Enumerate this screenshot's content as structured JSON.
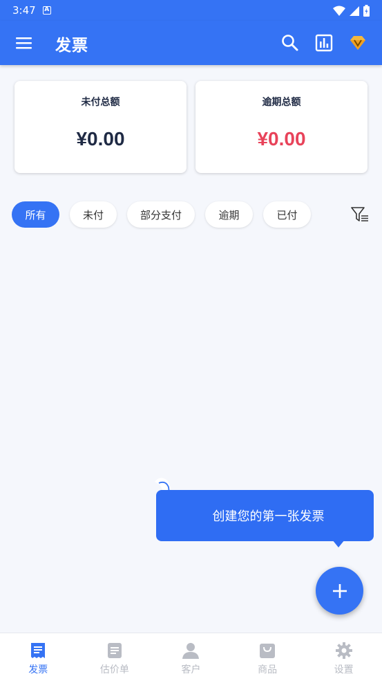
{
  "status_bar": {
    "time": "3:47",
    "notification_badge": "A"
  },
  "app_bar": {
    "title": "发票",
    "icons": [
      "menu-icon",
      "search-icon",
      "chart-icon",
      "premium-gem-icon"
    ]
  },
  "summary": {
    "unpaid": {
      "label": "未付总额",
      "amount": "¥0.00",
      "color": "#1f2a44"
    },
    "overdue": {
      "label": "逾期总额",
      "amount": "¥0.00",
      "color": "#e8435a"
    }
  },
  "filters": {
    "chips": [
      "所有",
      "未付",
      "部分支付",
      "逾期",
      "已付"
    ],
    "selected": "所有"
  },
  "tooltip": {
    "text": "创建您的第一张发票"
  },
  "bottom_nav": {
    "items": [
      {
        "label": "发票",
        "icon": "invoice-icon"
      },
      {
        "label": "估价单",
        "icon": "estimate-icon"
      },
      {
        "label": "客户",
        "icon": "customer-icon"
      },
      {
        "label": "商品",
        "icon": "product-icon"
      },
      {
        "label": "设置",
        "icon": "settings-icon"
      }
    ],
    "active": "发票"
  },
  "colors": {
    "primary": "#3573f4",
    "overdue": "#e8435a",
    "background": "#f5f7fc",
    "nav_inactive": "#b9bcc4"
  }
}
